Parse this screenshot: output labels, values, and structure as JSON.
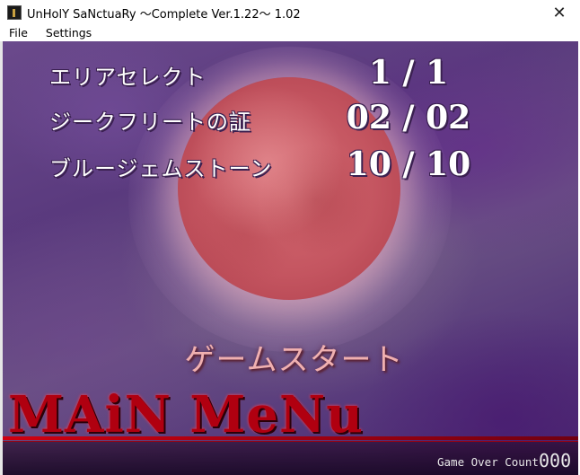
{
  "window": {
    "title": "UnHolY SaNctuaRy ～Complete Ver.1.22～ 1.02",
    "close_glyph": "✕",
    "icon": "app-icon"
  },
  "menubar": {
    "items": [
      "File",
      "Settings"
    ]
  },
  "stats": [
    {
      "label": "エリアセレクト",
      "value": "1 / 1"
    },
    {
      "label": "ジークフリートの証",
      "value": "02 / 02"
    },
    {
      "label": "ブルージェムストーン",
      "value": "10 / 10"
    }
  ],
  "start_label": "ゲームスタート",
  "main_menu_title": "MAiN MeNu",
  "game_over": {
    "label": "Game Over Count",
    "value": "000"
  },
  "colors": {
    "moon": "#c45560",
    "title_red": "#b00010",
    "background_purple": "#5a3a7e",
    "start_text": "#f0b0b0"
  }
}
